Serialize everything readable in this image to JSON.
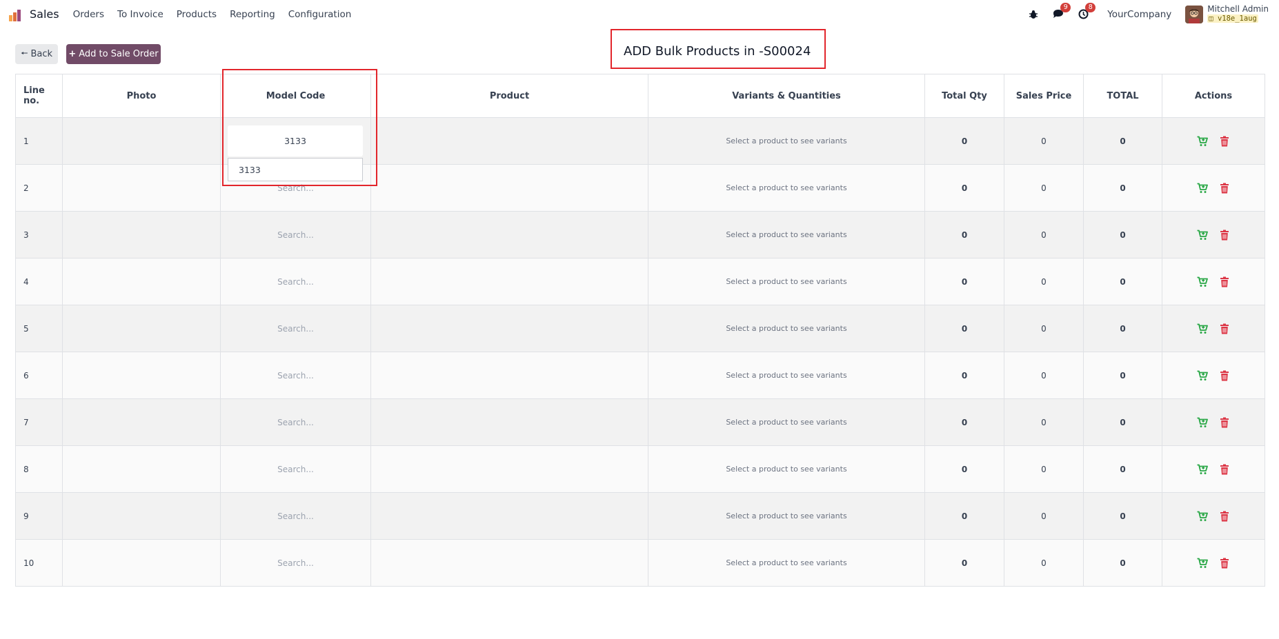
{
  "nav": {
    "app_name": "Sales",
    "menu": [
      "Orders",
      "To Invoice",
      "Products",
      "Reporting",
      "Configuration"
    ],
    "messages_count": "9",
    "activities_count": "8",
    "company": "YourCompany",
    "user_name": "Mitchell Admin",
    "db_name": "v18e_1aug"
  },
  "toolbar": {
    "back_label": "Back",
    "add_label": "Add to Sale Order",
    "title": "ADD Bulk Products in -S00024"
  },
  "table": {
    "headers": {
      "line_no": "Line no.",
      "photo": "Photo",
      "model_code": "Model Code",
      "product": "Product",
      "variants": "Variants & Quantities",
      "total_qty": "Total Qty",
      "sales_price": "Sales Price",
      "total": "TOTAL",
      "actions": "Actions"
    },
    "search_placeholder": "Search...",
    "rows": [
      {
        "line": "1",
        "model_code": "3133",
        "variants": "Select a product to see variants",
        "total_qty": "0",
        "sales_price": "0",
        "total": "0"
      },
      {
        "line": "2",
        "model_code": "",
        "variants": "Select a product to see variants",
        "total_qty": "0",
        "sales_price": "0",
        "total": "0"
      },
      {
        "line": "3",
        "model_code": "",
        "variants": "Select a product to see variants",
        "total_qty": "0",
        "sales_price": "0",
        "total": "0"
      },
      {
        "line": "4",
        "model_code": "",
        "variants": "Select a product to see variants",
        "total_qty": "0",
        "sales_price": "0",
        "total": "0"
      },
      {
        "line": "5",
        "model_code": "",
        "variants": "Select a product to see variants",
        "total_qty": "0",
        "sales_price": "0",
        "total": "0"
      },
      {
        "line": "6",
        "model_code": "",
        "variants": "Select a product to see variants",
        "total_qty": "0",
        "sales_price": "0",
        "total": "0"
      },
      {
        "line": "7",
        "model_code": "",
        "variants": "Select a product to see variants",
        "total_qty": "0",
        "sales_price": "0",
        "total": "0"
      },
      {
        "line": "8",
        "model_code": "",
        "variants": "Select a product to see variants",
        "total_qty": "0",
        "sales_price": "0",
        "total": "0"
      },
      {
        "line": "9",
        "model_code": "",
        "variants": "Select a product to see variants",
        "total_qty": "0",
        "sales_price": "0",
        "total": "0"
      },
      {
        "line": "10",
        "model_code": "",
        "variants": "Select a product to see variants",
        "total_qty": "0",
        "sales_price": "0",
        "total": "0"
      }
    ]
  },
  "model_code_search": {
    "value": "3133",
    "suggestion": "3133"
  },
  "icons": {
    "add_line": "cart-plus-icon",
    "delete_line": "trash-icon"
  },
  "colors": {
    "brand": "#714b67",
    "highlight": "#e2252b",
    "cart_green": "#28a745",
    "trash_red": "#dc3545",
    "badge_red": "#d23f3a"
  }
}
